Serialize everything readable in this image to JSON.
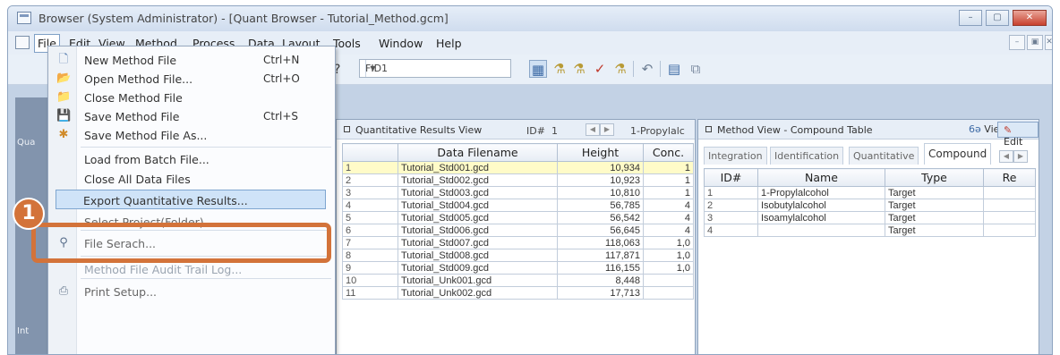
{
  "window": {
    "title": "Browser (System Administrator) - [Quant Browser - Tutorial_Method.gcm]",
    "controls": [
      "–",
      "▢",
      "✕"
    ]
  },
  "menubar": {
    "items": [
      "File",
      "Edit",
      "View",
      "Method",
      "Process",
      "Data",
      "Layout",
      "Tools",
      "Window",
      "Help"
    ]
  },
  "toolbar": {
    "detector": "FID1",
    "question": "?"
  },
  "file_menu": {
    "items": [
      {
        "label": "New Method File",
        "shortcut": "Ctrl+N",
        "icon": "new-file-icon"
      },
      {
        "label": "Open Method File...",
        "shortcut": "Ctrl+O",
        "icon": "open-folder-icon"
      },
      {
        "label": "Close Method File",
        "shortcut": "",
        "icon": "close-folder-icon"
      },
      {
        "label": "Save Method File",
        "shortcut": "Ctrl+S",
        "icon": "save-icon"
      },
      {
        "label": "Save Method File As...",
        "shortcut": "",
        "icon": "save-as-icon"
      },
      {
        "label": "Load from Batch File...",
        "shortcut": "",
        "icon": ""
      },
      {
        "label": "Close All Data Files",
        "shortcut": "",
        "icon": ""
      },
      {
        "label": "Export Quantitative Results...",
        "shortcut": "",
        "icon": ""
      },
      {
        "label": "Select Project(Folder)...",
        "shortcut": "",
        "icon": ""
      },
      {
        "label": "File Serach...",
        "shortcut": "",
        "icon": "binoculars-icon"
      },
      {
        "label": "Method File Audit Trail Log...",
        "shortcut": "",
        "icon": ""
      },
      {
        "label": "Print Setup...",
        "shortcut": "",
        "icon": "print-icon"
      }
    ]
  },
  "callout": {
    "number": "1"
  },
  "left_pane": {
    "label_top": "Qua",
    "label_bottom": "Int"
  },
  "quant_view": {
    "title": "Quantitative Results View",
    "id_label": "ID#",
    "id_value": "1",
    "compound": "1-Propylalc",
    "columns": [
      "",
      "Data Filename",
      "Height",
      "Conc."
    ],
    "rows": [
      {
        "n": "1",
        "file": "Tutorial_Std001.gcd",
        "height": "10,934",
        "conc": "1"
      },
      {
        "n": "2",
        "file": "Tutorial_Std002.gcd",
        "height": "10,923",
        "conc": "1"
      },
      {
        "n": "3",
        "file": "Tutorial_Std003.gcd",
        "height": "10,810",
        "conc": "1"
      },
      {
        "n": "4",
        "file": "Tutorial_Std004.gcd",
        "height": "56,785",
        "conc": "4"
      },
      {
        "n": "5",
        "file": "Tutorial_Std005.gcd",
        "height": "56,542",
        "conc": "4"
      },
      {
        "n": "6",
        "file": "Tutorial_Std006.gcd",
        "height": "56,645",
        "conc": "4"
      },
      {
        "n": "7",
        "file": "Tutorial_Std007.gcd",
        "height": "118,063",
        "conc": "1,0"
      },
      {
        "n": "8",
        "file": "Tutorial_Std008.gcd",
        "height": "117,871",
        "conc": "1,0"
      },
      {
        "n": "9",
        "file": "Tutorial_Std009.gcd",
        "height": "116,155",
        "conc": "1,0"
      },
      {
        "n": "10",
        "file": "Tutorial_Unk001.gcd",
        "height": "8,448",
        "conc": ""
      },
      {
        "n": "11",
        "file": "Tutorial_Unk002.gcd",
        "height": "17,713",
        "conc": ""
      }
    ]
  },
  "method_view": {
    "title": "Method View - Compound Table",
    "view_label": "View",
    "edit_label": "Edit",
    "tabs": [
      "Integration",
      "Identification",
      "Quantitative",
      "Compound"
    ],
    "active_tab": "Compound",
    "columns": [
      "ID#",
      "Name",
      "Type",
      "Re"
    ],
    "rows": [
      {
        "id": "1",
        "name": "1-Propylalcohol",
        "type": "Target"
      },
      {
        "id": "2",
        "name": "Isobutylalcohol",
        "type": "Target"
      },
      {
        "id": "3",
        "name": "Isoamylalcohol",
        "type": "Target"
      },
      {
        "id": "4",
        "name": "",
        "type": "Target"
      }
    ]
  }
}
